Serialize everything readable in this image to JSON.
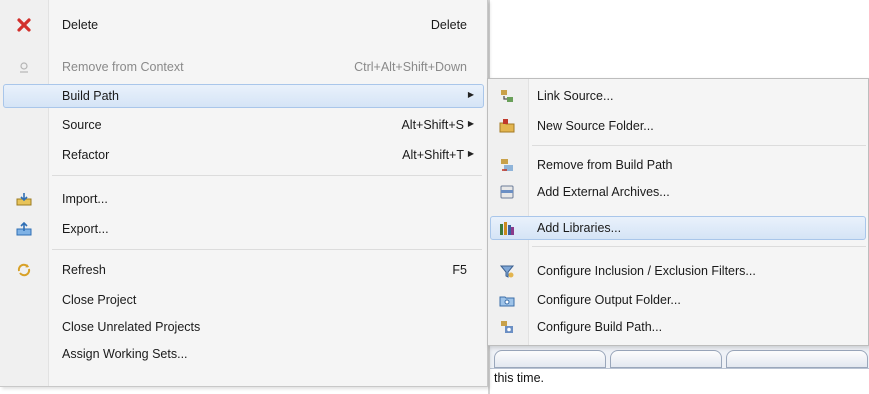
{
  "context_menu": {
    "items": [
      {
        "label": "Delete",
        "shortcut": "Delete",
        "icon": "delete-x-icon"
      },
      {
        "label": "Remove from Context",
        "shortcut": "Ctrl+Alt+Shift+Down",
        "icon": "remove-context-icon",
        "disabled": true
      },
      {
        "label": "Build Path",
        "icon": "",
        "submenu": true,
        "selected": true
      },
      {
        "label": "Source",
        "shortcut": "Alt+Shift+S",
        "submenu": true
      },
      {
        "label": "Refactor",
        "shortcut": "Alt+Shift+T",
        "submenu": true
      },
      {
        "label": "Import...",
        "icon": "import-icon"
      },
      {
        "label": "Export...",
        "icon": "export-icon"
      },
      {
        "label": "Refresh",
        "shortcut": "F5",
        "icon": "refresh-icon"
      },
      {
        "label": "Close Project"
      },
      {
        "label": "Close Unrelated Projects"
      },
      {
        "label": "Assign Working Sets..."
      }
    ]
  },
  "build_path_submenu": {
    "items": [
      {
        "label": "Link Source...",
        "icon": "link-source-icon"
      },
      {
        "label": "New Source Folder...",
        "icon": "new-source-folder-icon"
      },
      {
        "label": "Remove from Build Path",
        "icon": "remove-build-path-icon"
      },
      {
        "label": "Add External Archives...",
        "icon": "external-archive-icon"
      },
      {
        "label": "Add Libraries...",
        "icon": "library-icon",
        "selected": true
      },
      {
        "label": "Configure Inclusion / Exclusion Filters...",
        "icon": "filter-icon"
      },
      {
        "label": "Configure Output Folder...",
        "icon": "output-folder-icon"
      },
      {
        "label": "Configure Build Path...",
        "icon": "build-path-icon"
      }
    ]
  },
  "background": {
    "status_text": "this time."
  },
  "colors": {
    "menu_bg": "#f5f5f5",
    "selection_bg": "#dbe8f8",
    "selection_border": "#a9c6ea",
    "delete_red": "#d2302c",
    "disabled_text": "#8a8a8a"
  }
}
